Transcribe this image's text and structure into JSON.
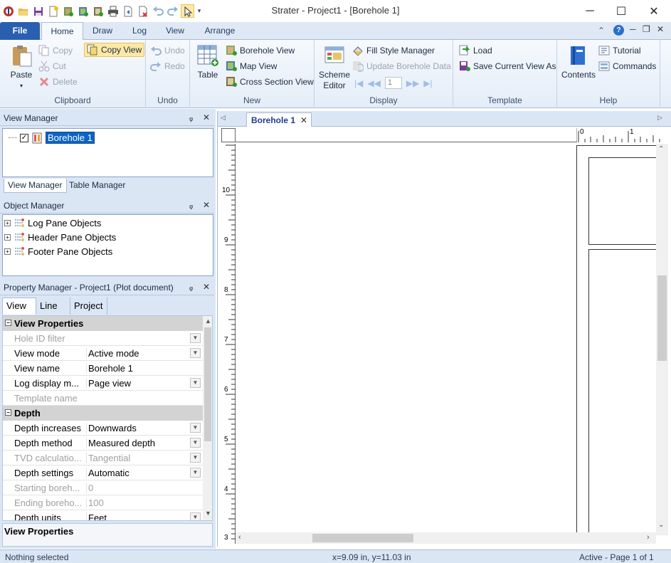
{
  "window": {
    "title": "Strater - Project1 - [Borehole 1]",
    "minimize": "─",
    "maximize": "☐",
    "close": "✕"
  },
  "ribbon_tabs": [
    "File",
    "Home",
    "Draw",
    "Log",
    "View",
    "Arrange"
  ],
  "ribbon": {
    "clipboard": {
      "label": "Clipboard",
      "paste": "Paste",
      "copy": "Copy",
      "cut": "Cut",
      "delete": "Delete",
      "copy_view": "Copy View"
    },
    "undo": {
      "label": "Undo",
      "undo": "Undo",
      "redo": "Redo"
    },
    "new": {
      "label": "New",
      "table": "Table",
      "borehole_view": "Borehole View",
      "map_view": "Map View",
      "cross_section_view": "Cross Section View"
    },
    "display": {
      "label": "Display",
      "scheme_editor_1": "Scheme",
      "scheme_editor_2": "Editor",
      "fill_style_manager": "Fill Style Manager",
      "update_borehole_data": "Update Borehole Data",
      "page_number": "1"
    },
    "template": {
      "label": "Template",
      "load": "Load",
      "save_current_view_as": "Save Current View As"
    },
    "help": {
      "label": "Help",
      "contents": "Contents",
      "tutorial": "Tutorial",
      "commands": "Commands"
    }
  },
  "view_manager": {
    "title": "View Manager",
    "item": "Borehole 1",
    "tabs": [
      "View Manager",
      "Table Manager"
    ]
  },
  "object_manager": {
    "title": "Object Manager",
    "items": [
      "Log Pane Objects",
      "Header Pane Objects",
      "Footer Pane Objects"
    ]
  },
  "property_manager": {
    "title": "Property Manager - Project1 (Plot document)",
    "tabs": [
      "View",
      "Line",
      "Project"
    ],
    "sections": {
      "view_properties": "View Properties",
      "depth": "Depth"
    },
    "rows_view": [
      {
        "key": "Hole ID filter",
        "value": ""
      },
      {
        "key": "View mode",
        "value": "Active mode"
      },
      {
        "key": "View name",
        "value": "Borehole 1"
      },
      {
        "key": "Log display m...",
        "value": "Page view"
      },
      {
        "key": "Template name",
        "value": ""
      }
    ],
    "rows_depth": [
      {
        "key": "Depth increases",
        "value": "Downwards"
      },
      {
        "key": "Depth method",
        "value": "Measured depth"
      },
      {
        "key": "TVD calculatio...",
        "value": "Tangential"
      },
      {
        "key": "Depth settings",
        "value": "Automatic"
      },
      {
        "key": "Starting boreh...",
        "value": "0"
      },
      {
        "key": "Ending boreho...",
        "value": "100"
      },
      {
        "key": "Depth units",
        "value": "Feet"
      }
    ],
    "description_title": "View Properties"
  },
  "document": {
    "tab": "Borehole 1",
    "vruler_labels": [
      "10",
      "9",
      "8",
      "7",
      "6",
      "5",
      "4",
      "3"
    ],
    "hruler_labels": [
      "0",
      "1"
    ]
  },
  "status": {
    "selection": "Nothing selected",
    "coords": "x=9.09 in, y=11.03 in",
    "page": "Active - Page 1 of 1"
  }
}
